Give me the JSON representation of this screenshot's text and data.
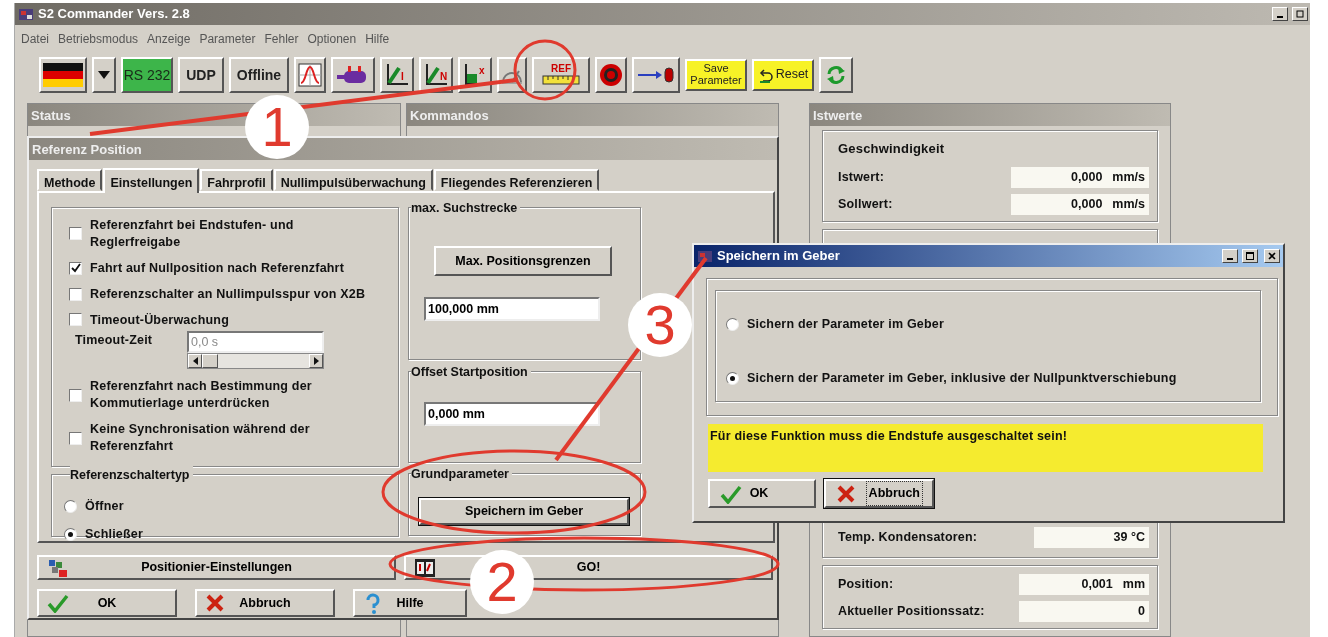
{
  "window": {
    "title": "S2 Commander Vers. 2.8"
  },
  "menu": [
    "Datei",
    "Betriebsmodus",
    "Anzeige",
    "Parameter",
    "Fehler",
    "Optionen",
    "Hilfe"
  ],
  "toolbar": [
    {
      "kind": "flag"
    },
    {
      "kind": "dropdown"
    },
    {
      "kind": "text",
      "label": "RS 232",
      "selected": true
    },
    {
      "kind": "text",
      "label": "UDP",
      "selected": false
    },
    {
      "kind": "text",
      "label": "Offline",
      "selected": false
    },
    {
      "kind": "icon"
    },
    {
      "kind": "icon"
    },
    {
      "kind": "icon",
      "label": "I"
    },
    {
      "kind": "icon",
      "label": "N"
    },
    {
      "kind": "icon",
      "label": "x"
    },
    {
      "kind": "icon"
    },
    {
      "kind": "icon",
      "label": "REF"
    },
    {
      "kind": "icon"
    },
    {
      "kind": "icon"
    },
    {
      "kind": "save",
      "label": "Save Parameter"
    },
    {
      "kind": "reset",
      "label": "Reset"
    },
    {
      "kind": "refresh"
    }
  ],
  "panels": [
    {
      "title": "Status"
    },
    {
      "title": "Kommandos"
    }
  ],
  "actual_values": {
    "title": "Istwerte",
    "groups": [
      {
        "title": "Geschwindigkeit",
        "rows": [
          {
            "label": "Istwert:",
            "value": "0,000",
            "unit": "mm/s"
          },
          {
            "label": "Sollwert:",
            "value": "0,000",
            "unit": "mm/s"
          }
        ]
      },
      {
        "rows": [
          {
            "label": "Temp. Kondensatoren:",
            "value": "39 °C"
          }
        ]
      },
      {
        "rows": [
          {
            "label": "Position:",
            "value": "0,001",
            "unit": "mm"
          },
          {
            "label": "Aktueller Positionssatz:",
            "value": "0"
          }
        ]
      }
    ]
  },
  "reference_window": {
    "title": "Referenz Position",
    "tabs": [
      {
        "label": "Methode",
        "selected": false
      },
      {
        "label": "Einstellungen",
        "selected": true
      },
      {
        "label": "Fahrprofil",
        "selected": false
      },
      {
        "label": "Nullimpulsüberwachung",
        "selected": false
      },
      {
        "label": "Fliegendes Referenzieren",
        "selected": false
      }
    ],
    "options": [
      {
        "kind": "checkbox",
        "label": "Referenzfahrt bei Endstufen- und\nReglerfreigabe",
        "checked": false
      },
      {
        "kind": "checkbox",
        "label": "Fahrt auf Nullposition nach Referenzfahrt",
        "checked": true
      },
      {
        "kind": "checkbox",
        "label": "Referenzschalter an Nullimpulsspur von X2B",
        "checked": false
      },
      {
        "kind": "checkbox",
        "label": "Timeout-Überwachung",
        "checked": false
      },
      {
        "kind": "timeout",
        "label": "Timeout-Zeit",
        "value": "0,0 s",
        "disabled": true
      },
      {
        "kind": "checkbox",
        "label": "Referenzfahrt nach Bestimmung der\nKommutierlage unterdrücken",
        "checked": false
      },
      {
        "kind": "checkbox",
        "label": "Keine Synchronisation während der\nReferenzfahrt",
        "checked": false
      }
    ],
    "switch_type": {
      "title": "Referenzschaltertyp",
      "options": [
        {
          "label": "Öffner",
          "selected": false
        },
        {
          "label": "Schließer",
          "selected": true
        }
      ]
    },
    "search_distance": {
      "title": "max. Suchstrecke",
      "button": "Max. Positionsgrenzen",
      "value": "100,000 mm"
    },
    "start_offset": {
      "title": "Offset Startposition",
      "value": "0,000 mm"
    },
    "basic_parameters": {
      "title": "Grundparameter",
      "button": "Speichern im Geber"
    },
    "action_buttons": [
      "Positionier-Einstellungen",
      "GO!"
    ],
    "buttons": [
      "OK",
      "Abbruch",
      "Hilfe"
    ]
  },
  "dialog": {
    "title": "Speichern im Geber",
    "options": [
      {
        "label": "Sichern der Parameter im Geber",
        "selected": false
      },
      {
        "label": "Sichern der Parameter im Geber, inklusive der Nullpunktverschiebung",
        "selected": true
      }
    ],
    "warning": "Für diese Funktion muss die Endstufe ausgeschaltet sein!",
    "buttons": [
      {
        "label": "OK",
        "focused": false
      },
      {
        "label": "Abbruch",
        "focused": true
      }
    ]
  },
  "annotations": [
    {
      "label": "1"
    },
    {
      "label": "2"
    },
    {
      "label": "3"
    }
  ]
}
